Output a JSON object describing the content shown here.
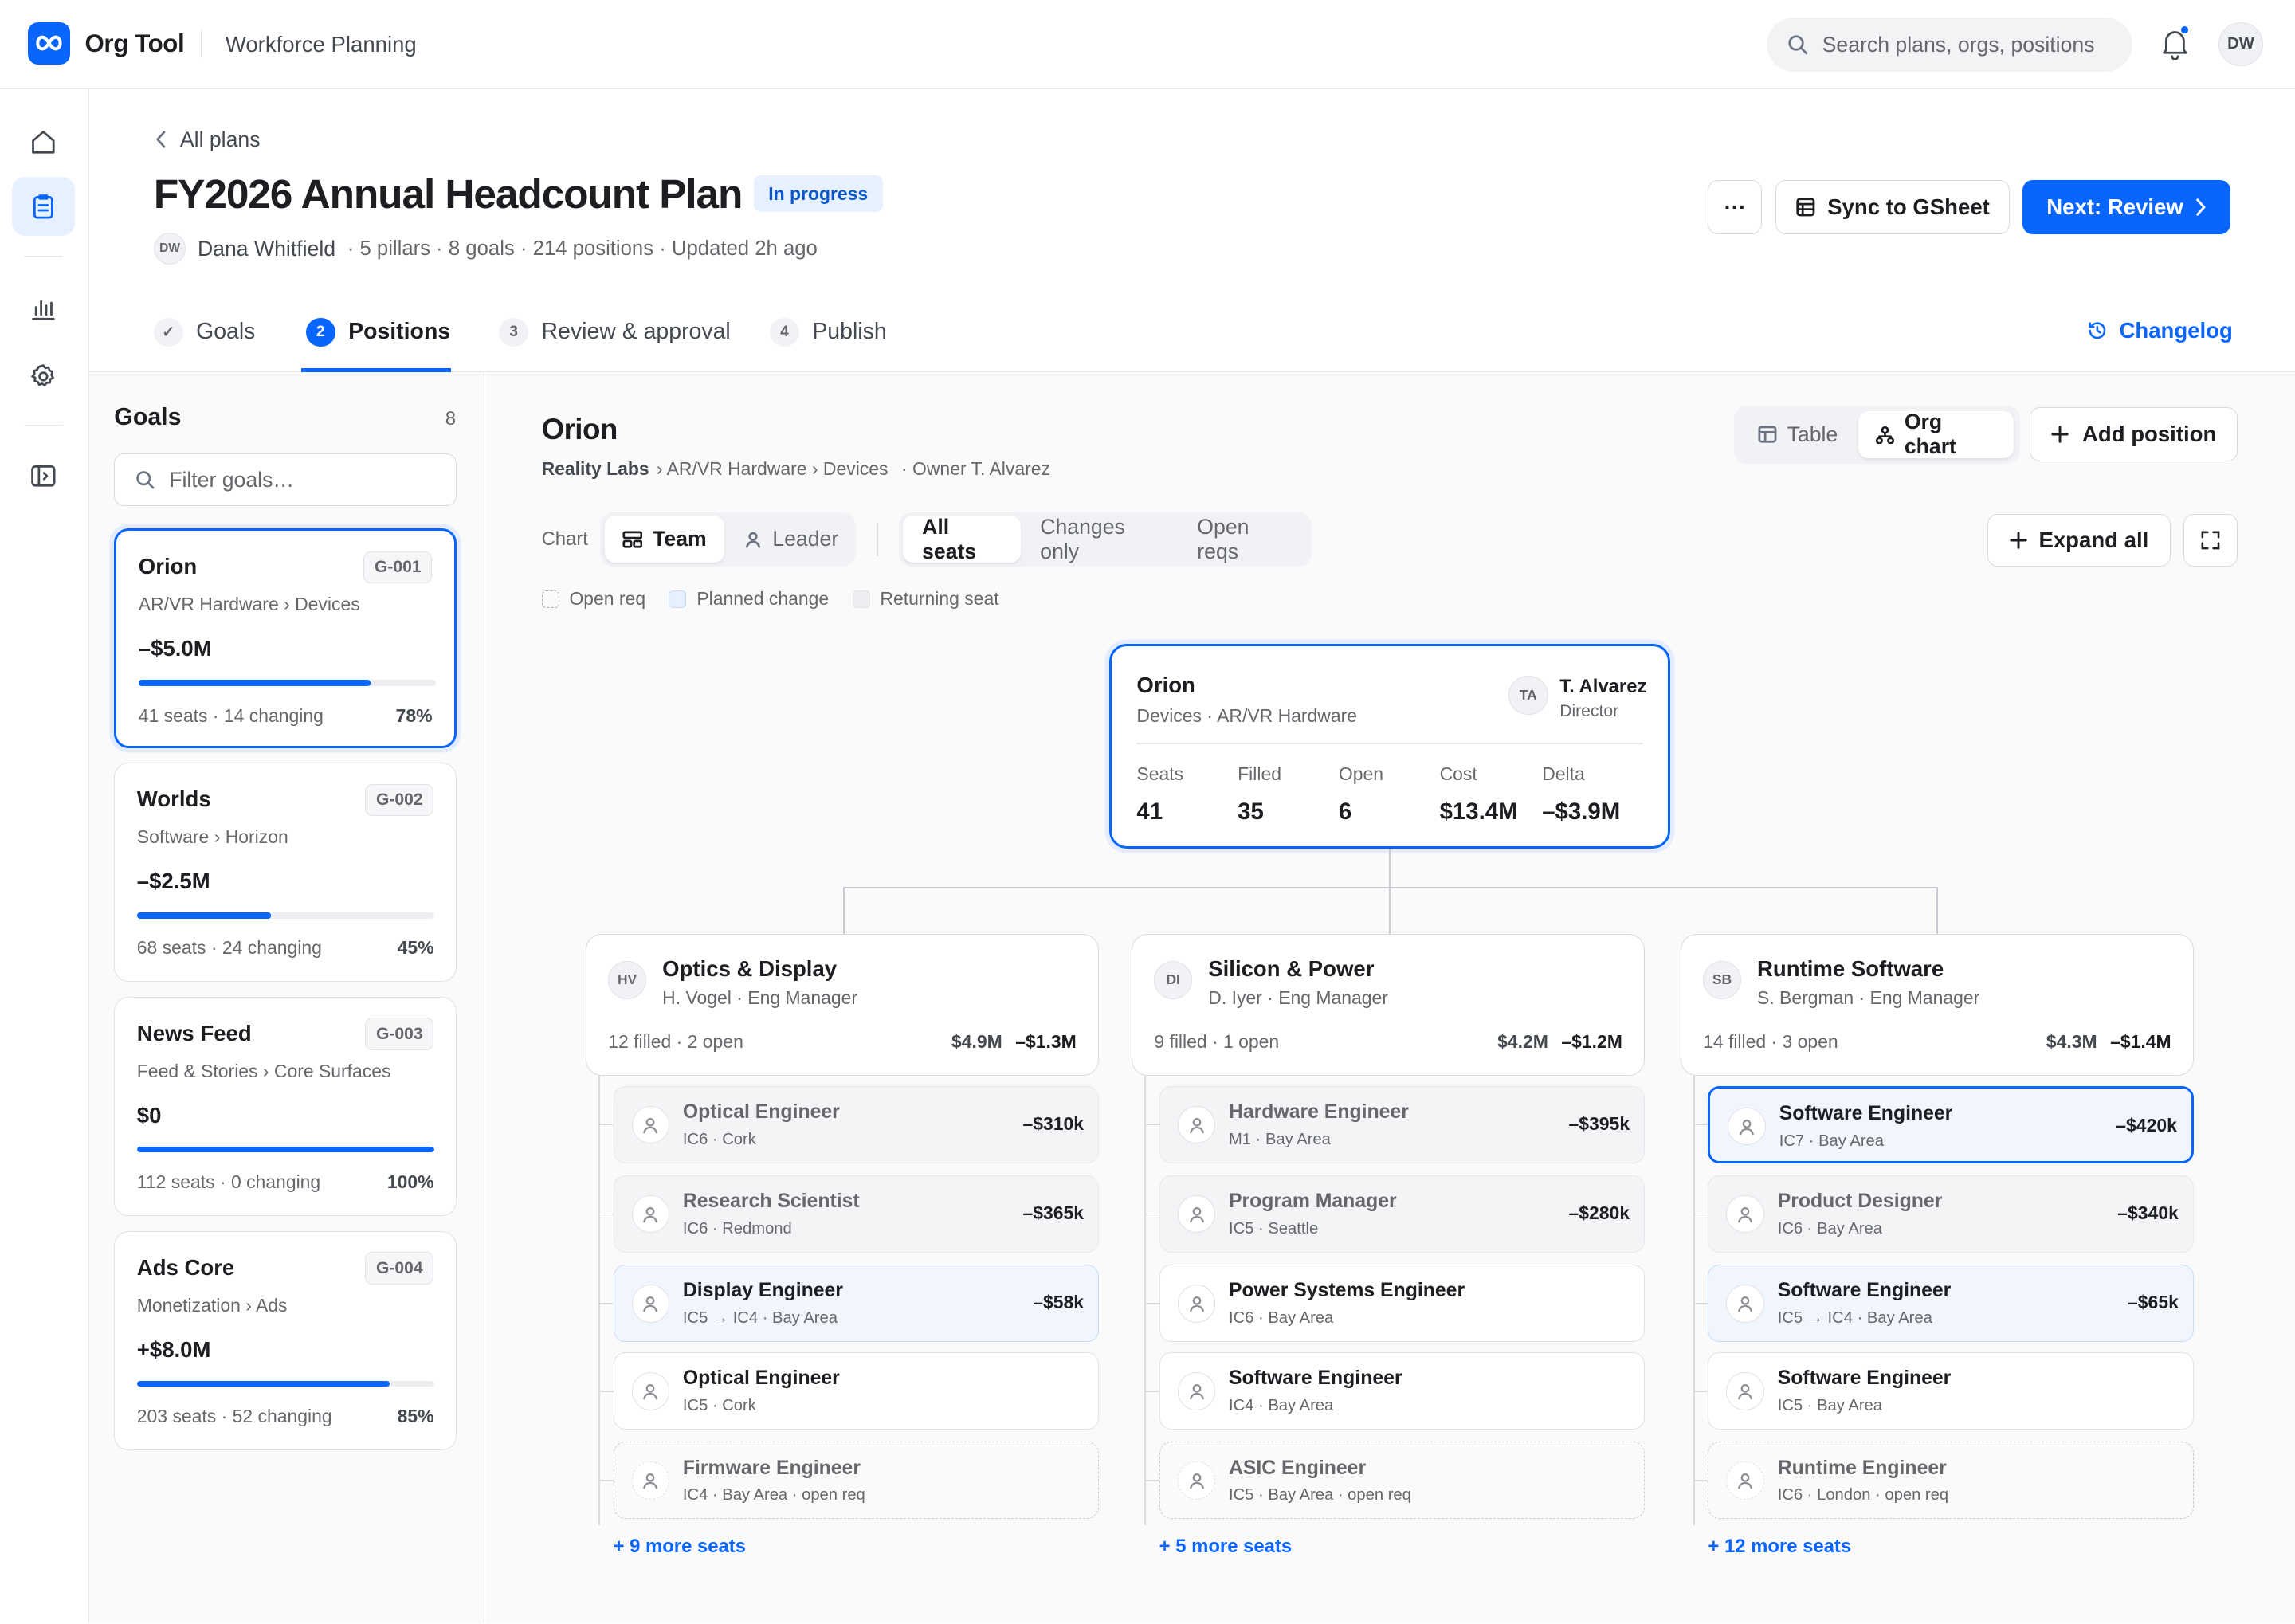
{
  "app": {
    "name": "Org Tool",
    "section": "Workforce Planning",
    "search_placeholder": "Search plans, orgs, positions",
    "user_initials": "DW",
    "accent": "#0866ff"
  },
  "header": {
    "back_label": "All plans",
    "title": "FY2026 Annual Headcount Plan",
    "status": "In progress",
    "owner_initials": "DW",
    "owner": "Dana Whitfield",
    "meta": "· 5 pillars · 8 goals · 214 positions · Updated 2h ago",
    "more_label": "···",
    "sync_label": "Sync to GSheet",
    "next_label": "Next: Review"
  },
  "steps": [
    {
      "num": "✓",
      "label": "Goals"
    },
    {
      "num": "2",
      "label": "Positions"
    },
    {
      "num": "3",
      "label": "Review & approval"
    },
    {
      "num": "4",
      "label": "Publish"
    }
  ],
  "changelog_label": "Changelog",
  "goals": {
    "title": "Goals",
    "count": "8",
    "filter_placeholder": "Filter goals…",
    "items": [
      {
        "name": "Orion",
        "id": "G-001",
        "sub": "AR/VR Hardware › Devices",
        "amount": "–$5.0M",
        "progress": 0.78,
        "foot": "41 seats · 14 changing",
        "pct": "78%"
      },
      {
        "name": "Worlds",
        "id": "G-002",
        "sub": "Software › Horizon",
        "amount": "–$2.5M",
        "progress": 0.45,
        "foot": "68 seats · 24 changing",
        "pct": "45%"
      },
      {
        "name": "News Feed",
        "id": "G-003",
        "sub": "Feed & Stories › Core Surfaces",
        "amount": "$0",
        "progress": 1.0,
        "foot": "112 seats · 0 changing",
        "pct": "100%"
      },
      {
        "name": "Ads Core",
        "id": "G-004",
        "sub": "Monetization › Ads",
        "amount": "+$8.0M",
        "progress": 0.85,
        "foot": "203 seats · 52 changing",
        "pct": "85%"
      }
    ]
  },
  "main": {
    "title": "Orion",
    "crumb_root": "Reality Labs",
    "crumb_rest": "› AR/VR Hardware › Devices",
    "crumb_owner": "·  Owner T. Alvarez",
    "view_table": "Table",
    "view_org": "Org chart",
    "add_position": "Add position",
    "chart_label": "Chart",
    "chart_team": "Team",
    "chart_leader": "Leader",
    "filters": [
      "All seats",
      "Changes only",
      "Open reqs"
    ],
    "expand_all": "Expand all",
    "legend": [
      "Open req",
      "Planned change",
      "Returning seat"
    ]
  },
  "root": {
    "name": "Orion",
    "sub": "Devices · AR/VR Hardware",
    "initials": "TA",
    "lead": "T. Alvarez",
    "role": "Director",
    "stats": [
      {
        "label": "Seats",
        "value": "41"
      },
      {
        "label": "Filled",
        "value": "35"
      },
      {
        "label": "Open",
        "value": "6"
      },
      {
        "label": "Cost",
        "value": "$13.4M"
      },
      {
        "label": "Delta",
        "value": "–$3.9M"
      }
    ]
  },
  "teams": [
    {
      "initials": "HV",
      "name": "Optics & Display",
      "lead": "H. Vogel · Eng Manager",
      "filled": "12 filled · 2 open",
      "cost": "$4.9M",
      "delta": "–$1.3M",
      "seats": [
        {
          "title": "Optical Engineer",
          "sub": "IC6 · Cork",
          "delta": "–$310k",
          "state": "grey"
        },
        {
          "title": "Research Scientist",
          "sub": "IC6 · Redmond",
          "delta": "–$365k",
          "state": "grey"
        },
        {
          "title": "Display Engineer",
          "sub": "IC5 → IC4 · Bay Area",
          "delta": "–$58k",
          "state": "plan"
        },
        {
          "title": "Optical Engineer",
          "sub": "IC5 · Cork",
          "delta": "",
          "state": "normal"
        },
        {
          "title": "Firmware Engineer",
          "sub": "IC4 · Bay Area · open req",
          "delta": "",
          "state": "openreq"
        }
      ],
      "more": "+ 9 more seats"
    },
    {
      "initials": "DI",
      "name": "Silicon & Power",
      "lead": "D. Iyer · Eng Manager",
      "filled": "9 filled · 1 open",
      "cost": "$4.2M",
      "delta": "–$1.2M",
      "seats": [
        {
          "title": "Hardware Engineer",
          "sub": "M1 · Bay Area",
          "delta": "–$395k",
          "state": "grey"
        },
        {
          "title": "Program Manager",
          "sub": "IC5 · Seattle",
          "delta": "–$280k",
          "state": "grey"
        },
        {
          "title": "Power Systems Engineer",
          "sub": "IC6 · Bay Area",
          "delta": "",
          "state": "normal"
        },
        {
          "title": "Software Engineer",
          "sub": "IC4 · Bay Area",
          "delta": "",
          "state": "normal"
        },
        {
          "title": "ASIC Engineer",
          "sub": "IC5 · Bay Area · open req",
          "delta": "",
          "state": "openreq"
        }
      ],
      "more": "+ 5 more seats"
    },
    {
      "initials": "SB",
      "name": "Runtime Software",
      "lead": "S. Bergman · Eng Manager",
      "filled": "14 filled · 3 open",
      "cost": "$4.3M",
      "delta": "–$1.4M",
      "seats": [
        {
          "title": "Software Engineer",
          "sub": "IC7 · Bay Area",
          "delta": "–$420k",
          "state": "sel"
        },
        {
          "title": "Product Designer",
          "sub": "IC6 · Bay Area",
          "delta": "–$340k",
          "state": "grey"
        },
        {
          "title": "Software Engineer",
          "sub": "IC5 → IC4 · Bay Area",
          "delta": "–$65k",
          "state": "plan"
        },
        {
          "title": "Software Engineer",
          "sub": "IC5 · Bay Area",
          "delta": "",
          "state": "normal"
        },
        {
          "title": "Runtime Engineer",
          "sub": "IC6 · London · open req",
          "delta": "",
          "state": "openreq"
        }
      ],
      "more": "+ 12 more seats"
    }
  ]
}
